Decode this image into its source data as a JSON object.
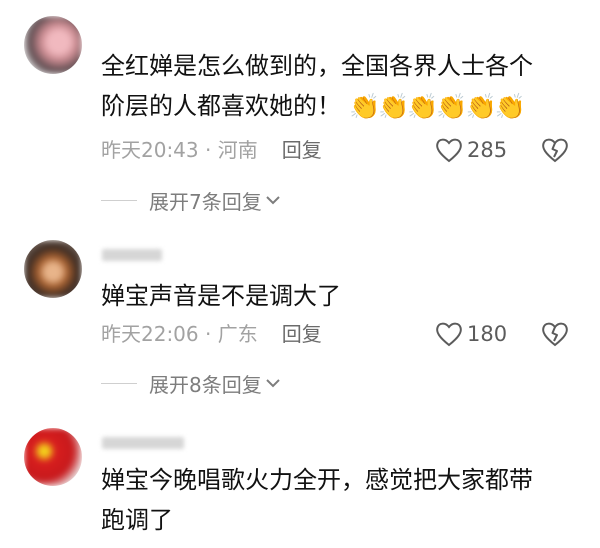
{
  "comments": [
    {
      "text_lines": [
        "全红婵是怎么做到的，全国各界人士各个",
        "阶层的人都喜欢她的！"
      ],
      "emoji": "👏👏👏👏👏👏",
      "time": "昨天20:43",
      "separator": " · ",
      "location": "河南",
      "reply_label": "回复",
      "likes": "285",
      "expand_label": "展开7条回复"
    },
    {
      "text_lines": [
        "婵宝声音是不是调大了"
      ],
      "time": "昨天22:06",
      "separator": " · ",
      "location": "广东",
      "reply_label": "回复",
      "likes": "180",
      "expand_label": "展开8条回复"
    },
    {
      "text_lines": [
        "婵宝今晚唱歌火力全开，感觉把大家都带",
        "跑调了"
      ]
    }
  ],
  "colors": {
    "text": "#111111",
    "meta": "#a2a2a2",
    "action": "#5b5b5b"
  }
}
